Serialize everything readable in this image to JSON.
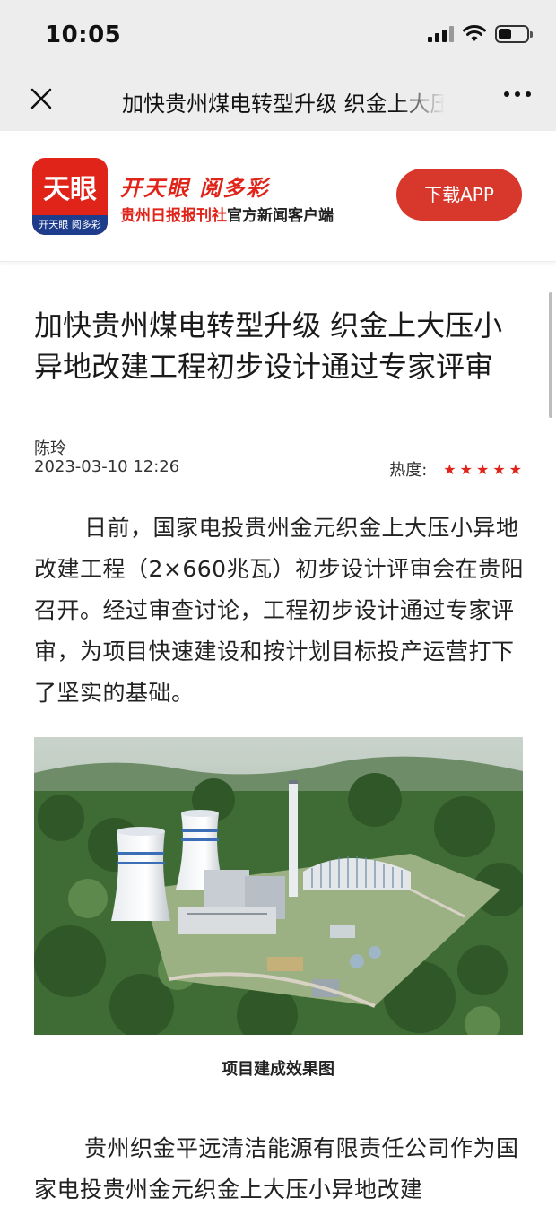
{
  "status": {
    "time": "10:05",
    "battery_level": 0.45
  },
  "nav": {
    "title": "加快贵州煤电转型升级 织金上大压小异地改建工程初步设计通过专家评审"
  },
  "banner": {
    "logo_text": "天眼",
    "logo_sub": "开天眼 阅多彩",
    "slogan": "开天眼 阅多彩",
    "sub_slogan_red": "贵州日报报刊社",
    "sub_slogan": "官方新闻客户端",
    "download_label": "下载APP"
  },
  "article": {
    "title": "加快贵州煤电转型升级 织金上大压小异地改建工程初步设计通过专家评审",
    "author": "陈玲",
    "date": "2023-03-10 12:26",
    "heat_label": "热度:",
    "heat_stars": 5,
    "para1": "日前，国家电投贵州金元织金上大压小异地改建工程（2×660兆瓦）初步设计评审会在贵阳召开。经过审查讨论，工程初步设计通过专家评审，为项目快速建设和按计划目标投产运营打下了坚实的基础。",
    "image_caption": "项目建成效果图",
    "para2": "贵州织金平远清洁能源有限责任公司作为国家电投贵州金元织金上大压小异地改建"
  },
  "colors": {
    "brand_red": "#e0241a",
    "button_red": "#d8372b",
    "nav_bg": "#ededed"
  }
}
